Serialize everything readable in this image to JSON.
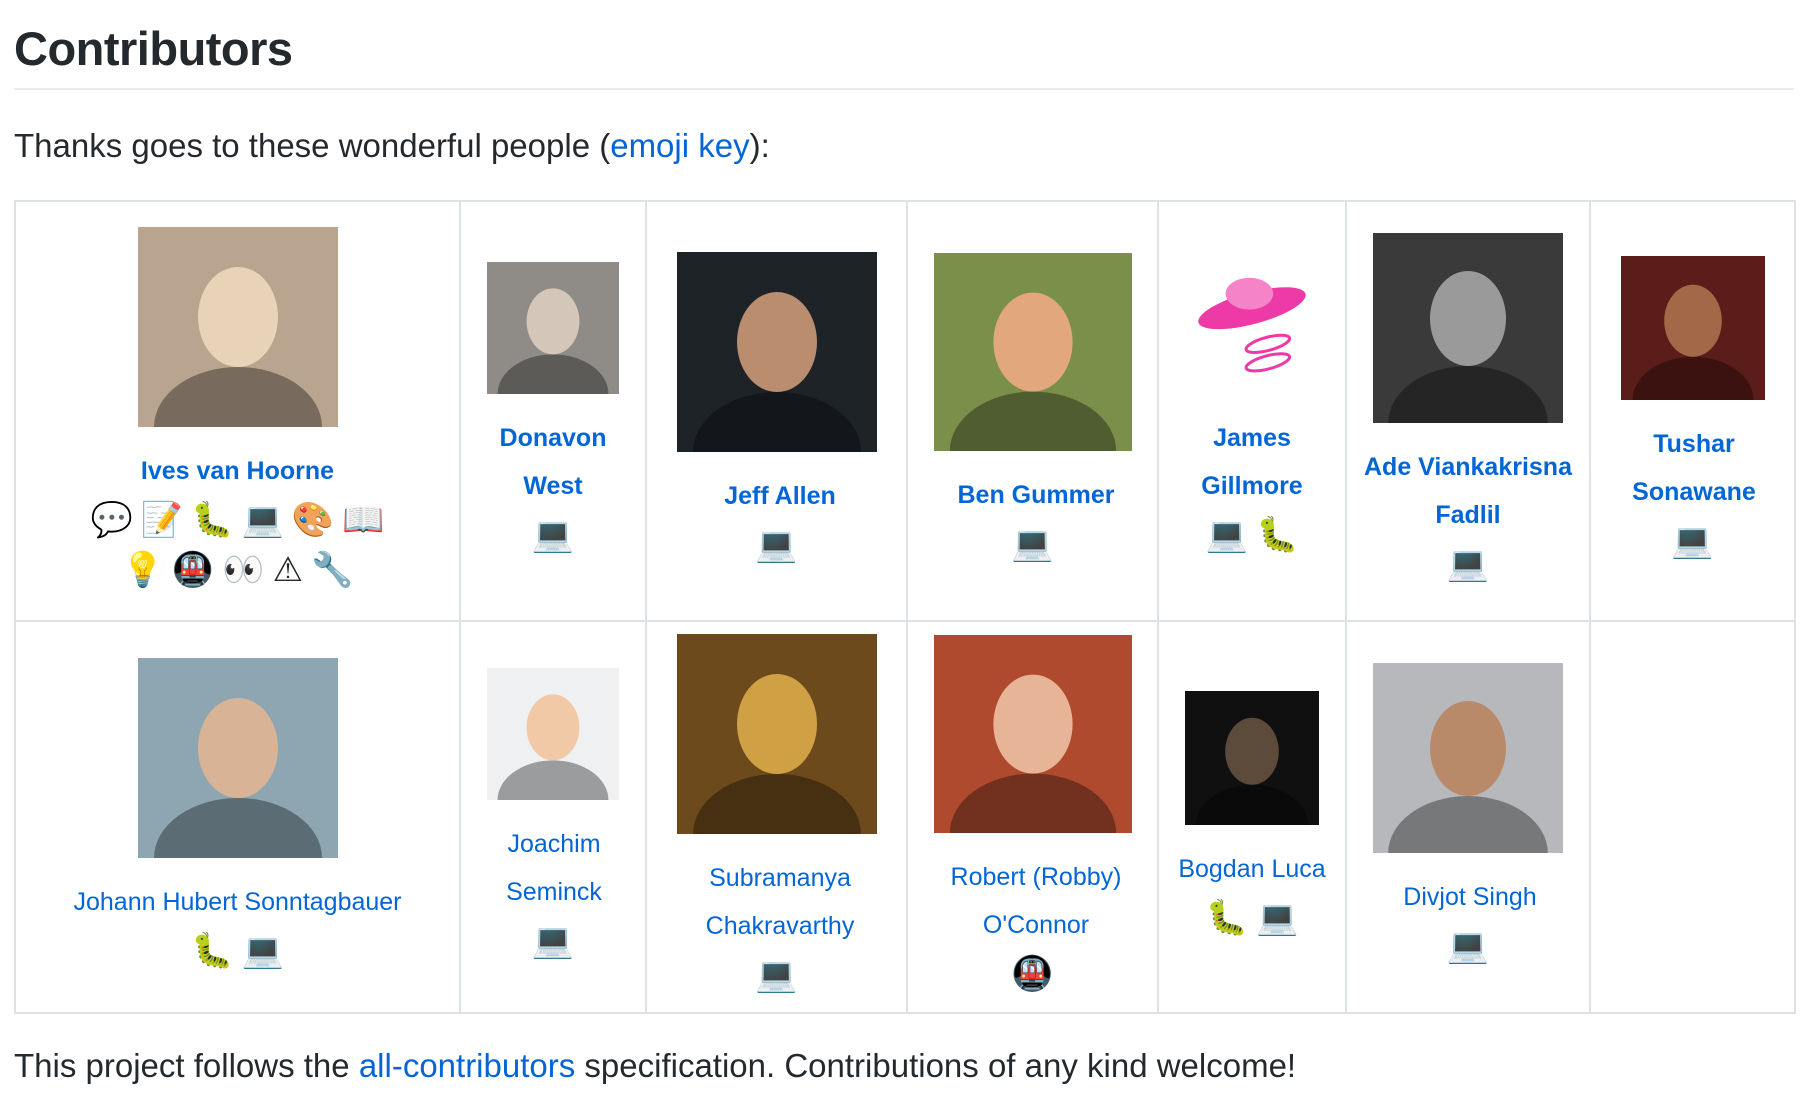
{
  "title": "Contributors",
  "intro": {
    "before": "Thanks goes to these wonderful people (",
    "link": "emoji key",
    "after": "):"
  },
  "footer": {
    "before": "This project follows the ",
    "link": "all-contributors",
    "after": " specification. Contributions of any kind welcome!"
  },
  "badge_glyphs": {
    "question": "💬",
    "doc": "📝",
    "bug": "🐛",
    "code": "💻",
    "design": "🎨",
    "book": "📖",
    "ideas": "💡",
    "infra": "🚇",
    "review": "👀",
    "warning": "⚠",
    "tool": "🔧"
  },
  "contributors": [
    [
      {
        "name": "Ives van Hoorne",
        "bold": true,
        "avatar": {
          "bg": "#b9a58f",
          "fg": "#e8d3b9"
        },
        "badges": [
          "question",
          "doc",
          "bug",
          "code",
          "design",
          "book",
          "ideas",
          "infra",
          "review",
          "warning",
          "tool"
        ]
      },
      {
        "name": "Donavon West",
        "bold": true,
        "avatar": {
          "bg": "#8f8c88",
          "fg": "#d4c6b8"
        },
        "badges": [
          "code"
        ]
      },
      {
        "name": "Jeff Allen",
        "bold": true,
        "avatar": {
          "bg": "#1e2328",
          "fg": "#b98d6e"
        },
        "badges": [
          "code"
        ]
      },
      {
        "name": "Ben Gummer",
        "bold": true,
        "avatar": {
          "bg": "#7a8f4a",
          "fg": "#e3a77c"
        },
        "badges": [
          "code"
        ]
      },
      {
        "name": "James Gillmore",
        "bold": true,
        "avatar": {
          "bg": "#ffffff",
          "fg": "#ee3aa6"
        },
        "badges": [
          "code",
          "bug"
        ]
      },
      {
        "name": "Ade Viankakrisna Fadlil",
        "bold": true,
        "avatar": {
          "bg": "#3a3a3a",
          "fg": "#9a9a9a"
        },
        "badges": [
          "code"
        ]
      },
      {
        "name": "Tushar Sonawane",
        "bold": true,
        "avatar": {
          "bg": "#5b1d1a",
          "fg": "#a26848"
        },
        "badges": [
          "code"
        ]
      }
    ],
    [
      {
        "name": "Johann Hubert Sonntagbauer",
        "bold": false,
        "avatar": {
          "bg": "#8ea6b2",
          "fg": "#d9b396"
        },
        "badges": [
          "bug",
          "code"
        ]
      },
      {
        "name": "Joachim Seminck",
        "bold": false,
        "avatar": {
          "bg": "#eef0f1",
          "fg": "#f2c9a6"
        },
        "badges": [
          "code"
        ]
      },
      {
        "name": "Subramanya Chakravarthy",
        "bold": false,
        "avatar": {
          "bg": "#6d4a1c",
          "fg": "#d0a044"
        },
        "badges": [
          "code"
        ]
      },
      {
        "name": "Robert (Robby) O'Connor",
        "bold": false,
        "avatar": {
          "bg": "#b04a2e",
          "fg": "#e8b498"
        },
        "badges": [
          "infra"
        ]
      },
      {
        "name": "Bogdan Luca",
        "bold": false,
        "avatar": {
          "bg": "#101010",
          "fg": "#5c4a3a"
        },
        "badges": [
          "bug",
          "code"
        ]
      },
      {
        "name": "Divjot Singh",
        "bold": false,
        "avatar": {
          "bg": "#b6b8bb",
          "fg": "#b98a6a"
        },
        "badges": [
          "code"
        ]
      },
      null
    ]
  ]
}
